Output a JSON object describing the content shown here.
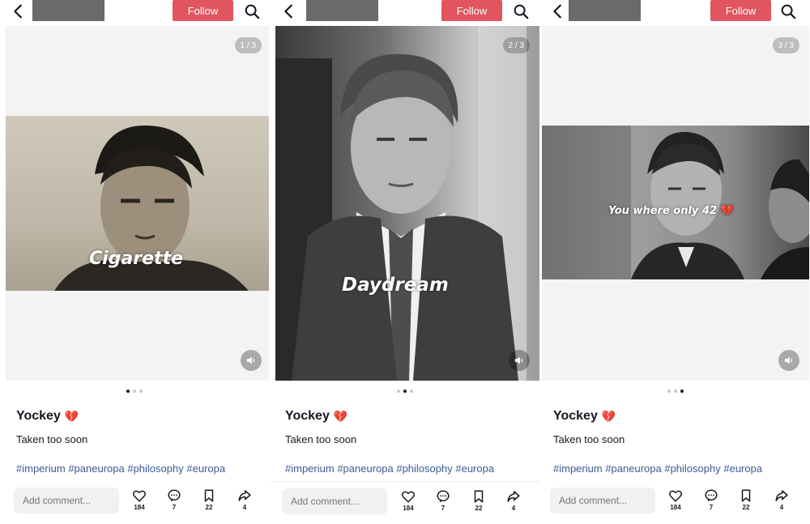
{
  "header": {
    "follow_label": "Follow"
  },
  "post": {
    "author": "Yockey",
    "author_emoji": "💔",
    "description": "Taken too soon",
    "tags": [
      "#imperium",
      "#paneuropa",
      "#philosophy",
      "#europa"
    ],
    "comment_placeholder": "Add comment...",
    "likes": "184",
    "comments": "7",
    "saves": "22",
    "shares": "4"
  },
  "slides": [
    {
      "counter": "1 / 3",
      "overlay": "Cigarette",
      "active_dot": 0
    },
    {
      "counter": "2 / 3",
      "overlay": "Daydream",
      "active_dot": 1
    },
    {
      "counter": "3 / 3",
      "overlay": "You where only 42",
      "overlay_emoji": "💔",
      "active_dot": 2
    }
  ],
  "colors": {
    "follow_bg": "#e0555f",
    "hashtag": "#3d5a96",
    "text": "#161823"
  },
  "icons": [
    "back-arrow-icon",
    "search-icon",
    "sound-icon",
    "heart-icon",
    "comment-icon",
    "bookmark-icon",
    "share-icon"
  ]
}
